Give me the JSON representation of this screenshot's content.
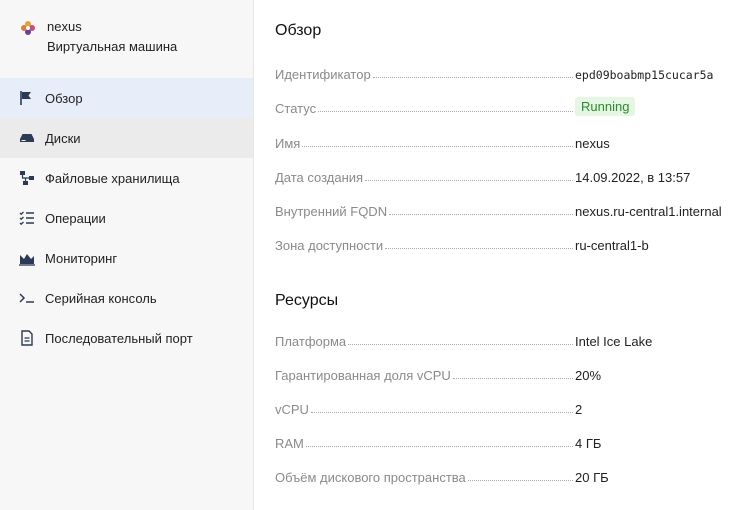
{
  "vm": {
    "name": "nexus",
    "type": "Виртуальная машина"
  },
  "nav": [
    {
      "label": "Обзор",
      "icon": "flag-icon",
      "state": "active"
    },
    {
      "label": "Диски",
      "icon": "disk-icon",
      "state": "hover"
    },
    {
      "label": "Файловые хранилища",
      "icon": "file-storage-icon",
      "state": ""
    },
    {
      "label": "Операции",
      "icon": "operations-list-icon",
      "state": ""
    },
    {
      "label": "Мониторинг",
      "icon": "monitoring-chart-icon",
      "state": ""
    },
    {
      "label": "Серийная консоль",
      "icon": "terminal-icon",
      "state": ""
    },
    {
      "label": "Последовательный порт",
      "icon": "document-icon",
      "state": ""
    }
  ],
  "overview": {
    "title": "Обзор",
    "rows": [
      {
        "label": "Идентификатор",
        "value": "epd09boabmp15cucar5a",
        "kind": "mono"
      },
      {
        "label": "Статус",
        "value": "Running",
        "kind": "badge"
      },
      {
        "label": "Имя",
        "value": "nexus",
        "kind": "text"
      },
      {
        "label": "Дата создания",
        "value": "14.09.2022, в 13:57",
        "kind": "text"
      },
      {
        "label": "Внутренний FQDN",
        "value": "nexus.ru-central1.internal",
        "kind": "text"
      },
      {
        "label": "Зона доступности",
        "value": "ru-central1-b",
        "kind": "text"
      }
    ]
  },
  "resources": {
    "title": "Ресурсы",
    "rows": [
      {
        "label": "Платформа",
        "value": "Intel Ice Lake",
        "kind": "text"
      },
      {
        "label": "Гарантированная доля vCPU",
        "value": "20%",
        "kind": "text"
      },
      {
        "label": "vCPU",
        "value": "2",
        "kind": "text"
      },
      {
        "label": "RAM",
        "value": "4 ГБ",
        "kind": "text"
      },
      {
        "label": "Объём дискового пространства",
        "value": "20 ГБ",
        "kind": "text"
      }
    ]
  },
  "colors": {
    "status_running_bg": "#e5f6e2",
    "status_running_text": "#2b8c2b",
    "active_nav_bg": "#e7eef9"
  }
}
